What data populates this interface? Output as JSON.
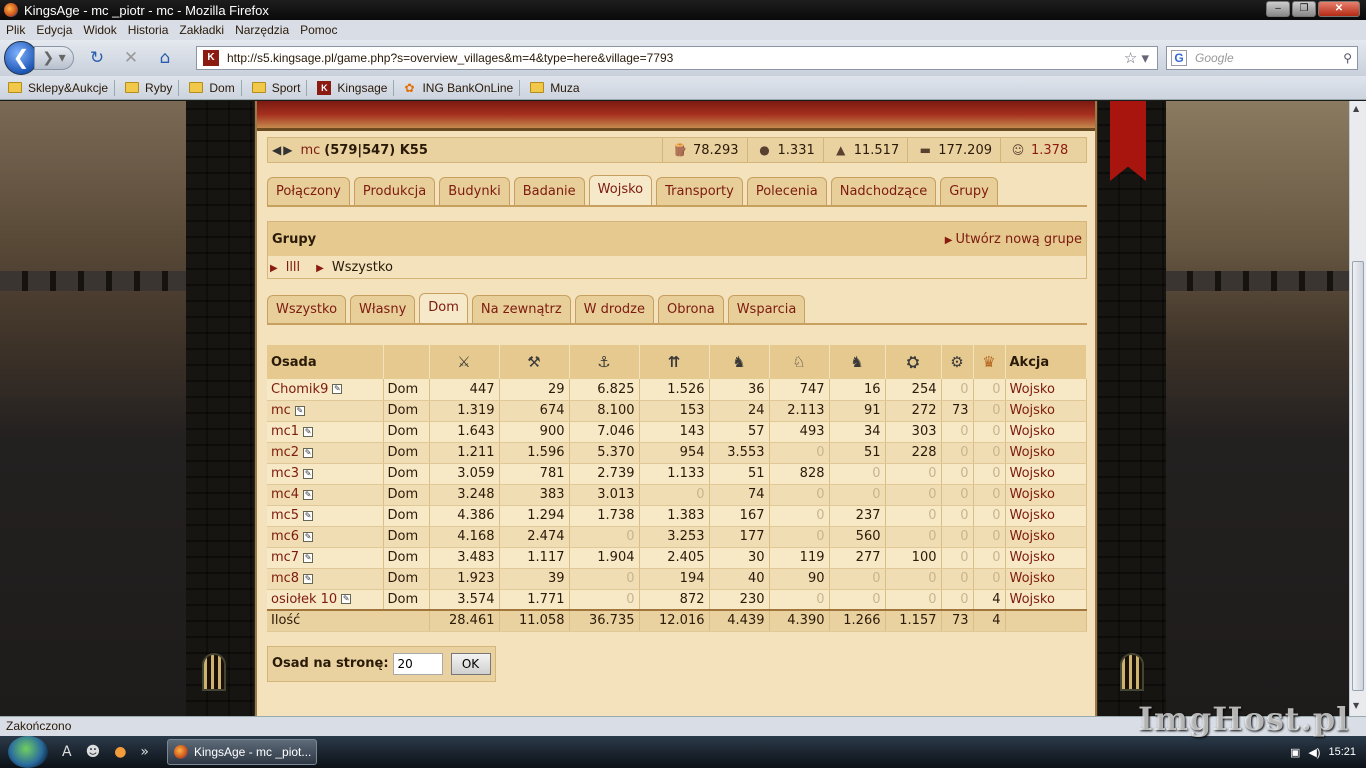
{
  "window": {
    "title": "KingsAge - mc _piotr - mc - Mozilla Firefox"
  },
  "menu": [
    "Plik",
    "Edycja",
    "Widok",
    "Historia",
    "Zakładki",
    "Narzędzia",
    "Pomoc"
  ],
  "nav": {
    "url": "http://s5.kingsage.pl/game.php?s=overview_villages&m=4&type=here&village=7793",
    "search_placeholder": "Google"
  },
  "bookmarks": [
    {
      "label": "Sklepy&Aukcje",
      "icon": "folder-icon"
    },
    {
      "label": "Ryby",
      "icon": "folder-icon"
    },
    {
      "label": "Dom",
      "icon": "folder-icon"
    },
    {
      "label": "Sport",
      "icon": "folder-icon"
    },
    {
      "label": "Kingsage",
      "icon": "kingsage-icon"
    },
    {
      "label": "ING BankOnLine",
      "icon": "ing-icon"
    },
    {
      "label": "Muza",
      "icon": "folder-icon"
    }
  ],
  "village_bar": {
    "name": "mc",
    "coords": "(579|547) K55",
    "resources": {
      "wood": "78.293",
      "stone": "1.331",
      "iron": "11.517",
      "storage": "177.209"
    },
    "population": "1.378"
  },
  "main_tabs": [
    "Połączony",
    "Produkcja",
    "Budynki",
    "Badanie",
    "Wojsko",
    "Transporty",
    "Polecenia",
    "Nadchodzące",
    "Grupy"
  ],
  "main_tab_active": 4,
  "groups": {
    "title": "Grupy",
    "new_group": "Utwórz nową grupe",
    "links": [
      "llll",
      "Wszystko"
    ]
  },
  "sub_tabs": [
    "Wszystko",
    "Własny",
    "Dom",
    "Na zewnątrz",
    "W drodze",
    "Obrona",
    "Wsparcia"
  ],
  "sub_tab_active": 2,
  "table": {
    "headers": {
      "village": "Osada",
      "action": "Akcja"
    },
    "unit_icons": [
      "sword-icon",
      "axe-icon",
      "battleaxe-icon",
      "spear-icon",
      "scout-horse-icon",
      "light-cavalry-icon",
      "heavy-cavalry-icon",
      "ram-icon",
      "catapult-icon",
      "crown-icon"
    ],
    "rows": [
      {
        "village": "Chomik9",
        "type": "Dom",
        "units": [
          "447",
          "29",
          "6.825",
          "1.526",
          "36",
          "747",
          "16",
          "254",
          "0",
          "0"
        ],
        "action": "Wojsko"
      },
      {
        "village": "mc",
        "type": "Dom",
        "units": [
          "1.319",
          "674",
          "8.100",
          "153",
          "24",
          "2.113",
          "91",
          "272",
          "73",
          "0"
        ],
        "action": "Wojsko"
      },
      {
        "village": "mc1",
        "type": "Dom",
        "units": [
          "1.643",
          "900",
          "7.046",
          "143",
          "57",
          "493",
          "34",
          "303",
          "0",
          "0"
        ],
        "action": "Wojsko"
      },
      {
        "village": "mc2",
        "type": "Dom",
        "units": [
          "1.211",
          "1.596",
          "5.370",
          "954",
          "3.553",
          "0",
          "51",
          "228",
          "0",
          "0"
        ],
        "action": "Wojsko"
      },
      {
        "village": "mc3",
        "type": "Dom",
        "units": [
          "3.059",
          "781",
          "2.739",
          "1.133",
          "51",
          "828",
          "0",
          "0",
          "0",
          "0"
        ],
        "action": "Wojsko"
      },
      {
        "village": "mc4",
        "type": "Dom",
        "units": [
          "3.248",
          "383",
          "3.013",
          "0",
          "74",
          "0",
          "0",
          "0",
          "0",
          "0"
        ],
        "action": "Wojsko"
      },
      {
        "village": "mc5",
        "type": "Dom",
        "units": [
          "4.386",
          "1.294",
          "1.738",
          "1.383",
          "167",
          "0",
          "237",
          "0",
          "0",
          "0"
        ],
        "action": "Wojsko"
      },
      {
        "village": "mc6",
        "type": "Dom",
        "units": [
          "4.168",
          "2.474",
          "0",
          "3.253",
          "177",
          "0",
          "560",
          "0",
          "0",
          "0"
        ],
        "action": "Wojsko"
      },
      {
        "village": "mc7",
        "type": "Dom",
        "units": [
          "3.483",
          "1.117",
          "1.904",
          "2.405",
          "30",
          "119",
          "277",
          "100",
          "0",
          "0"
        ],
        "action": "Wojsko"
      },
      {
        "village": "mc8",
        "type": "Dom",
        "units": [
          "1.923",
          "39",
          "0",
          "194",
          "40",
          "90",
          "0",
          "0",
          "0",
          "0"
        ],
        "action": "Wojsko"
      },
      {
        "village": "osiołek 10",
        "type": "Dom",
        "units": [
          "3.574",
          "1.771",
          "0",
          "872",
          "230",
          "0",
          "0",
          "0",
          "0",
          "4"
        ],
        "action": "Wojsko"
      }
    ],
    "total": {
      "label": "Ilość",
      "units": [
        "28.461",
        "11.058",
        "36.735",
        "12.016",
        "4.439",
        "4.390",
        "1.266",
        "1.157",
        "73",
        "4"
      ]
    }
  },
  "pager": {
    "label": "Osad na stronę:",
    "value": "20",
    "button": "OK"
  },
  "status": "Zakończono",
  "taskbar": {
    "task": "KingsAge - mc _piot...",
    "clock": "15:21"
  },
  "watermark": "ImgHost.pl"
}
